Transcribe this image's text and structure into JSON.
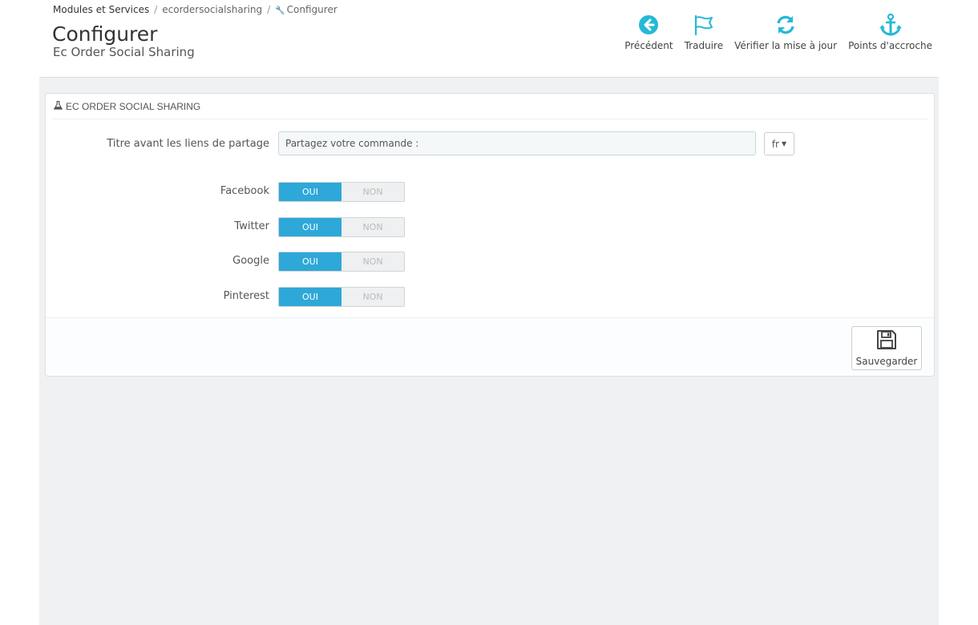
{
  "breadcrumb": {
    "root": "Modules et Services",
    "module": "ecordersocialsharing",
    "current": "Configurer"
  },
  "header": {
    "title": "Configurer",
    "subtitle": "Ec Order Social Sharing"
  },
  "toolbar": {
    "back": "Précédent",
    "translate": "Traduire",
    "check_update": "Vérifier la mise à jour",
    "hooks": "Points d'accroche"
  },
  "panel": {
    "heading": "EC ORDER SOCIAL SHARING",
    "title_field": {
      "label": "Titre avant les liens de partage",
      "value": "Partagez votre commande :",
      "lang": "fr"
    },
    "switches": [
      {
        "label": "Facebook",
        "yes": "OUI",
        "no": "NON",
        "value": "yes"
      },
      {
        "label": "Twitter",
        "yes": "OUI",
        "no": "NON",
        "value": "yes"
      },
      {
        "label": "Google",
        "yes": "OUI",
        "no": "NON",
        "value": "yes"
      },
      {
        "label": "Pinterest",
        "yes": "OUI",
        "no": "NON",
        "value": "yes"
      }
    ],
    "save": "Sauvegarder"
  },
  "colors": {
    "accent": "#2ea8d8",
    "toolbar_icon": "#25b9d7"
  }
}
